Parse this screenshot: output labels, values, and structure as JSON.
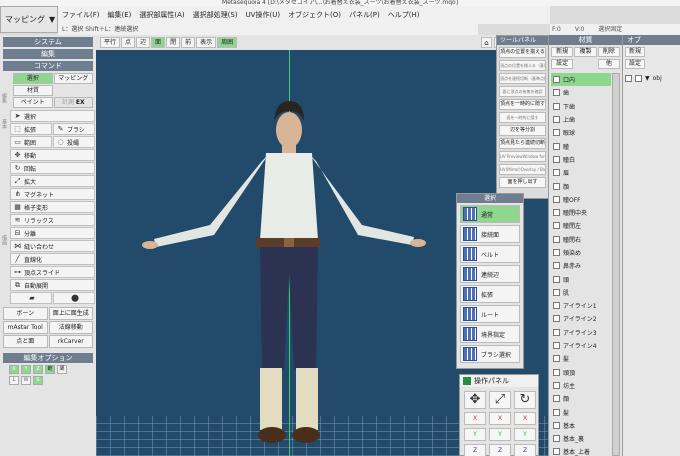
{
  "app": {
    "title": "Metasequoia 4 [D:\\メタセコイア\\...\\お着替え衣装_スーツ\\お着替え衣装_スーツ.mqo]"
  },
  "mode": {
    "label": "マッピング"
  },
  "menu": [
    "ファイル(F)",
    "編集(E)",
    "選択部属性(A)",
    "選択部処理(S)",
    "UV操作(U)",
    "オブジェクト(O)",
    "パネル(P)",
    "ヘルプ(H)"
  ],
  "hint": "L：選択  Shift＋L：連続選択",
  "status": {
    "f": "F:0",
    "v": "V:0",
    "sel": "選択固定"
  },
  "left": {
    "system": "システム",
    "edit": "編集",
    "command": "コマンド",
    "tabs": [
      "選択",
      "マッピング"
    ],
    "material_tab": "材質",
    "paint": "ペイント",
    "measure": "計測",
    "ex": "EX",
    "side_labels": [
      "編集",
      "基本",
      "描画",
      "その他"
    ],
    "commands": [
      {
        "label": "選択",
        "icon": "cursor-icon",
        "wide": true
      },
      {
        "label": "拡張",
        "icon": "extend-icon"
      },
      {
        "label": "ブラシ",
        "icon": "brush-icon"
      },
      {
        "label": "範囲",
        "icon": "range-icon"
      },
      {
        "label": "投縄",
        "icon": "lasso-icon"
      },
      {
        "label": "移動",
        "icon": "move-icon",
        "wide": true
      },
      {
        "label": "回転",
        "icon": "rotate-icon",
        "wide": true
      },
      {
        "label": "拡大",
        "icon": "scale-icon",
        "wide": true
      },
      {
        "label": "マグネット",
        "icon": "magnet-icon",
        "wide": true
      },
      {
        "label": "格子変形",
        "icon": "lattice-icon",
        "wide": true
      },
      {
        "label": "リラックス",
        "icon": "relax-icon",
        "wide": true
      },
      {
        "label": "分離",
        "icon": "split-icon",
        "wide": true
      },
      {
        "label": "縫い合わせ",
        "icon": "stitch-icon",
        "wide": true
      },
      {
        "label": "直線化",
        "icon": "straighten-icon",
        "wide": true
      },
      {
        "label": "頂点スライド",
        "icon": "vertex-slide-icon",
        "wide": true
      },
      {
        "label": "自動展開",
        "icon": "auto-unwrap-icon",
        "wide": true
      },
      {
        "label": "",
        "icon": "plane-icon"
      },
      {
        "label": "",
        "icon": "cylinder-icon"
      }
    ],
    "bottom_buttons": [
      [
        "ボーン",
        "面上に面生成"
      ],
      [
        "mAstar Tool",
        "法線移動"
      ],
      [
        "点と面",
        "rkCarver"
      ]
    ],
    "edit_options": "編集オプション",
    "opts_row1": [
      "X",
      "Y",
      "Z",
      "範",
      "縄"
    ],
    "opts_row2": [
      "L",
      "W",
      "S"
    ]
  },
  "viewport": {
    "tools": [
      "平行",
      "点",
      "辺",
      "面",
      "閉",
      "前",
      "表示",
      "周囲"
    ]
  },
  "tool_panel": {
    "title": "ツールパネル",
    "buttons": [
      "頂点の位置を揃える",
      "頂点を一時的に隠す",
      "辺を等分割",
      "頂点見たら連続切断",
      "面を押し出す"
    ],
    "tiny": [
      "頂点の位置を揃える（基準点指定）",
      "頂点を連続切断（基準点指定）",
      "面を一時的に隠す",
      "面に頂点の有無を確認",
      "UV PreviewWindow for Blender",
      "UV(Mirror)Overlay / Blender"
    ]
  },
  "select_panel": {
    "title": "選択",
    "items": [
      "通常",
      "接続面",
      "ベルト",
      "連続辺",
      "拡張",
      "ルート",
      "境界指定",
      "ブラシ選択"
    ]
  },
  "op_panel": {
    "title": "操作パネル",
    "rows": [
      [
        "X",
        "X",
        "X"
      ],
      [
        "Y",
        "Y",
        "Y"
      ],
      [
        "Z",
        "Z",
        "Z"
      ]
    ]
  },
  "material_panel": {
    "title": "材質",
    "buttons1": [
      "新規",
      "複製",
      "削除"
    ],
    "buttons2": [
      "設定",
      "",
      "他"
    ],
    "items": [
      "口内",
      "歯",
      "下歯",
      "上歯",
      "眼球",
      "瞳",
      "瞳白",
      "眉",
      "顔",
      "瞳OFF",
      "瞳閉中央",
      "瞳閉左",
      "瞳閉右",
      "頬染め",
      "鼻赤み",
      "頭",
      "肌",
      "アイライン1",
      "アイライン2",
      "アイライン3",
      "アイライン4",
      "髪",
      "頭頂",
      "坊主",
      "顔",
      "髪",
      "基本",
      "基本_裏",
      "基本_上着"
    ],
    "selected": 0
  },
  "object_panel": {
    "title": "オブ",
    "buttons": [
      "新規",
      "設定"
    ],
    "item": "obj"
  }
}
